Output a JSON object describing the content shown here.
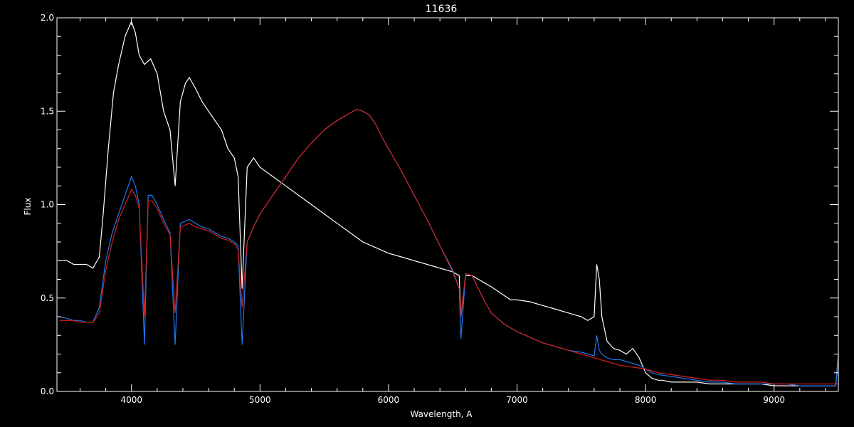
{
  "chart_data": {
    "type": "line",
    "title": "11636",
    "xlabel": "Wavelength, A",
    "ylabel": "Flux",
    "xlim": [
      3420,
      9500
    ],
    "ylim": [
      0,
      2
    ],
    "xticks": [
      4000,
      5000,
      6000,
      7000,
      8000,
      9000
    ],
    "xtick_labels": [
      "4000",
      "5000",
      "6000",
      "7000",
      "8000",
      "9000"
    ],
    "yticks": [
      0,
      0.5,
      1,
      1.5,
      2
    ],
    "ytick_labels": [
      "0.0",
      "0.5",
      "1.0",
      "1.5",
      "2.0"
    ],
    "grid": false,
    "colors": {
      "background": "#000000",
      "axes": "#ffffff",
      "observed": "#ffffff",
      "model": "#1e78f0",
      "fit": "#d62020"
    },
    "series": [
      {
        "color": "#ffffff",
        "x": [
          3440,
          3500,
          3550,
          3600,
          3650,
          3700,
          3750,
          3780,
          3820,
          3860,
          3900,
          3950,
          4000,
          4030,
          4060,
          4100,
          4150,
          4200,
          4250,
          4300,
          4340,
          4380,
          4420,
          4450,
          4500,
          4550,
          4600,
          4650,
          4700,
          4750,
          4800,
          4830,
          4861,
          4900,
          4950,
          5000,
          5100,
          5200,
          5300,
          5400,
          5500,
          5600,
          5700,
          5800,
          5900,
          6000,
          6100,
          6200,
          6300,
          6400,
          6500,
          6550,
          6563,
          6600,
          6650,
          6700,
          6750,
          6800,
          6950,
          7000,
          7100,
          7200,
          7300,
          7400,
          7500,
          7550,
          7600,
          7620,
          7640,
          7660,
          7700,
          7750,
          7800,
          7850,
          7900,
          7950,
          8000,
          8050,
          8100,
          8130,
          8200,
          8300,
          8400,
          8500,
          8600,
          8700,
          8800,
          8900,
          9000,
          9100,
          9200,
          9300,
          9400,
          9450,
          9480,
          9500
        ],
        "y": [
          0.7,
          0.7,
          0.68,
          0.68,
          0.68,
          0.66,
          0.72,
          0.95,
          1.3,
          1.6,
          1.75,
          1.9,
          1.98,
          1.92,
          1.8,
          1.75,
          1.78,
          1.7,
          1.5,
          1.4,
          1.1,
          1.55,
          1.65,
          1.68,
          1.62,
          1.55,
          1.5,
          1.45,
          1.4,
          1.3,
          1.25,
          1.15,
          0.55,
          1.2,
          1.25,
          1.2,
          1.15,
          1.1,
          1.05,
          1.0,
          0.95,
          0.9,
          0.85,
          0.8,
          0.77,
          0.74,
          0.72,
          0.7,
          0.68,
          0.66,
          0.64,
          0.62,
          0.4,
          0.62,
          0.62,
          0.6,
          0.58,
          0.56,
          0.49,
          0.49,
          0.48,
          0.46,
          0.44,
          0.42,
          0.4,
          0.38,
          0.4,
          0.68,
          0.6,
          0.4,
          0.27,
          0.23,
          0.22,
          0.2,
          0.23,
          0.18,
          0.1,
          0.07,
          0.06,
          0.06,
          0.05,
          0.05,
          0.05,
          0.04,
          0.04,
          0.04,
          0.04,
          0.04,
          0.03,
          0.03,
          0.03,
          0.03,
          0.03,
          0.03,
          0.03,
          0.2
        ]
      },
      {
        "color": "#1e78f0",
        "x": [
          3440,
          3500,
          3550,
          3600,
          3650,
          3700,
          3750,
          3800,
          3850,
          3900,
          3950,
          4000,
          4030,
          4060,
          4101,
          4130,
          4160,
          4200,
          4250,
          4300,
          4340,
          4380,
          4450,
          4500,
          4550,
          4600,
          4650,
          4700,
          4750,
          4800,
          4830,
          4861,
          4900,
          4950,
          5000,
          5100,
          5200,
          5300,
          5400,
          5500,
          5600,
          5700,
          5750,
          5800,
          5850,
          5900,
          5950,
          6000,
          6100,
          6200,
          6300,
          6400,
          6500,
          6550,
          6563,
          6600,
          6650,
          6700,
          6750,
          6800,
          6900,
          7000,
          7100,
          7200,
          7300,
          7400,
          7500,
          7550,
          7600,
          7620,
          7640,
          7660,
          7700,
          7750,
          7800,
          7850,
          7900,
          7950,
          8000,
          8050,
          8100,
          8200,
          8300,
          8400,
          8500,
          8600,
          8700,
          8800,
          8900,
          9000,
          9100,
          9200,
          9300,
          9400,
          9450,
          9480,
          9500
        ],
        "y": [
          0.4,
          0.39,
          0.38,
          0.38,
          0.37,
          0.37,
          0.45,
          0.7,
          0.85,
          0.95,
          1.05,
          1.15,
          1.1,
          1.0,
          0.25,
          1.05,
          1.05,
          1.0,
          0.92,
          0.85,
          0.25,
          0.9,
          0.92,
          0.9,
          0.88,
          0.87,
          0.85,
          0.83,
          0.82,
          0.8,
          0.78,
          0.25,
          0.8,
          0.88,
          0.95,
          1.05,
          1.15,
          1.25,
          1.33,
          1.4,
          1.45,
          1.49,
          1.51,
          1.5,
          1.48,
          1.43,
          1.36,
          1.3,
          1.18,
          1.05,
          0.92,
          0.78,
          0.65,
          0.55,
          0.28,
          0.63,
          0.62,
          0.55,
          0.48,
          0.42,
          0.36,
          0.32,
          0.29,
          0.26,
          0.24,
          0.22,
          0.21,
          0.2,
          0.19,
          0.3,
          0.22,
          0.2,
          0.18,
          0.17,
          0.17,
          0.16,
          0.15,
          0.14,
          0.12,
          0.1,
          0.09,
          0.08,
          0.07,
          0.06,
          0.05,
          0.05,
          0.04,
          0.04,
          0.04,
          0.04,
          0.04,
          0.03,
          0.03,
          0.03,
          0.03,
          0.03,
          0.2
        ]
      },
      {
        "color": "#d62020",
        "x": [
          3440,
          3500,
          3550,
          3600,
          3650,
          3700,
          3750,
          3800,
          3850,
          3900,
          3950,
          4000,
          4030,
          4060,
          4101,
          4130,
          4160,
          4200,
          4250,
          4300,
          4340,
          4380,
          4450,
          4500,
          4550,
          4600,
          4650,
          4700,
          4750,
          4800,
          4830,
          4861,
          4900,
          4950,
          5000,
          5100,
          5200,
          5300,
          5400,
          5500,
          5600,
          5700,
          5750,
          5800,
          5850,
          5900,
          5950,
          6000,
          6100,
          6200,
          6300,
          6400,
          6500,
          6550,
          6563,
          6600,
          6650,
          6700,
          6750,
          6800,
          6900,
          7000,
          7100,
          7200,
          7300,
          7400,
          7500,
          7600,
          7700,
          7800,
          7900,
          8000,
          8100,
          8200,
          8300,
          8400,
          8500,
          8600,
          8700,
          8800,
          8900,
          9000,
          9100,
          9200,
          9300,
          9400,
          9500
        ],
        "y": [
          0.38,
          0.38,
          0.38,
          0.37,
          0.37,
          0.37,
          0.42,
          0.65,
          0.8,
          0.92,
          1.0,
          1.08,
          1.05,
          0.98,
          0.4,
          1.02,
          1.02,
          0.98,
          0.9,
          0.84,
          0.42,
          0.88,
          0.9,
          0.88,
          0.87,
          0.86,
          0.84,
          0.82,
          0.81,
          0.79,
          0.76,
          0.45,
          0.8,
          0.88,
          0.95,
          1.05,
          1.15,
          1.25,
          1.33,
          1.4,
          1.45,
          1.49,
          1.51,
          1.5,
          1.48,
          1.43,
          1.36,
          1.3,
          1.18,
          1.05,
          0.92,
          0.78,
          0.64,
          0.55,
          0.4,
          0.63,
          0.62,
          0.55,
          0.48,
          0.42,
          0.36,
          0.32,
          0.29,
          0.26,
          0.24,
          0.22,
          0.2,
          0.18,
          0.16,
          0.14,
          0.13,
          0.12,
          0.1,
          0.09,
          0.08,
          0.07,
          0.06,
          0.06,
          0.05,
          0.05,
          0.05,
          0.04,
          0.04,
          0.04,
          0.04,
          0.04,
          0.04
        ]
      }
    ]
  }
}
